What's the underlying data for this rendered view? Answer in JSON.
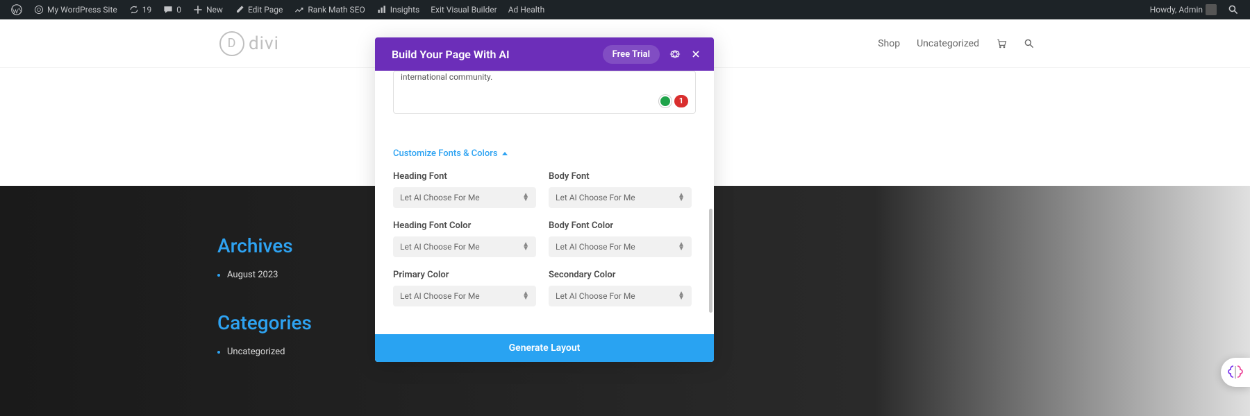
{
  "adminbar": {
    "site_name": "My WordPress Site",
    "sync_count": "19",
    "comments_count": "0",
    "new_label": "New",
    "edit_page": "Edit Page",
    "rank_math": "Rank Math SEO",
    "insights": "Insights",
    "exit_vb": "Exit Visual Builder",
    "ad_health": "Ad Health",
    "howdy": "Howdy, Admin"
  },
  "header": {
    "logo_text": "divi",
    "logo_letter": "D",
    "nav": {
      "shop": "Shop",
      "uncategorized": "Uncategorized"
    }
  },
  "sidebar": {
    "archives_title": "Archives",
    "archives_item": "August 2023",
    "categories_title": "Categories",
    "categories_item": "Uncategorized"
  },
  "modal": {
    "title": "Build Your Page With AI",
    "free_trial": "Free Trial",
    "prompt_fragment": "international community.",
    "badge_count": "1",
    "customize_label": "Customize Fonts & Colors",
    "fields": {
      "heading_font": "Heading Font",
      "body_font": "Body Font",
      "heading_font_color": "Heading Font Color",
      "body_font_color": "Body Font Color",
      "primary_color": "Primary Color",
      "secondary_color": "Secondary Color"
    },
    "select_default": "Let AI Choose For Me",
    "generate": "Generate Layout"
  }
}
